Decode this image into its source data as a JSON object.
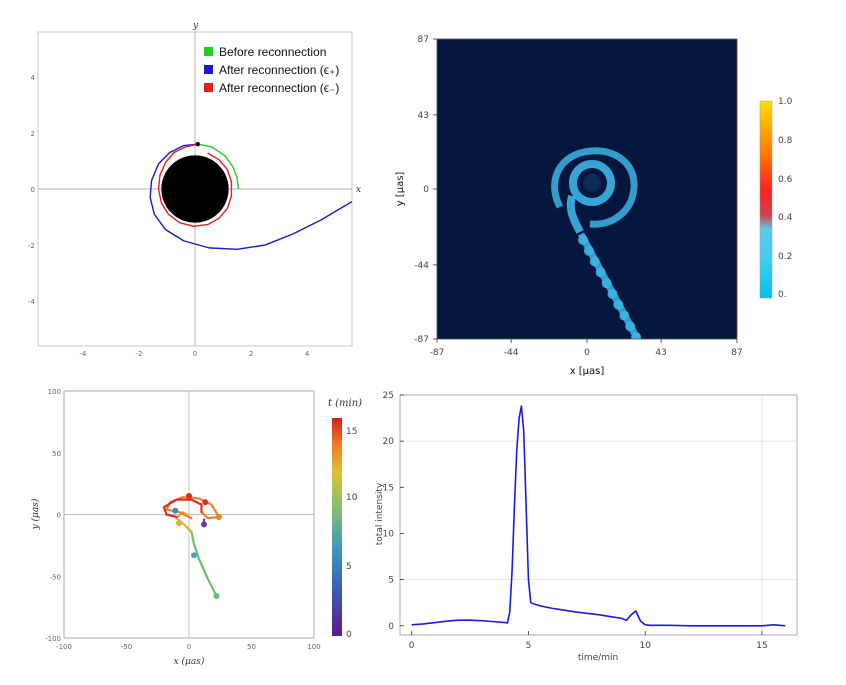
{
  "colors": {
    "before": "#22cc22",
    "after_plus": "#1a1acc",
    "after_minus": "#e02020",
    "black_hole": "#000000",
    "image_bg": "#05173c",
    "blob": "#3cb4e6",
    "intensity_line": "#1a1ae0"
  },
  "chart_data": [
    {
      "type": "line",
      "panel": "top-left",
      "xlabel": "x",
      "ylabel": "y",
      "xlim": [
        -5.6,
        5.6
      ],
      "ylim": [
        -5.6,
        5.6
      ],
      "xticks": [
        "-4",
        "-2",
        "0",
        "2",
        "4"
      ],
      "yticks": [
        "-4",
        "-2",
        "0",
        "2",
        "4"
      ],
      "legend": [
        {
          "label": "Before reconnection",
          "color": "#22cc22"
        },
        {
          "label": "After reconnection (ϵ₊)",
          "color": "#1a1acc"
        },
        {
          "label": "After reconnection (ϵ₋)",
          "color": "#e02020"
        }
      ],
      "legend_position": "top-right",
      "black_hole_radius": 1.2,
      "series": [
        {
          "name": "Before reconnection",
          "points": [
            [
              1.55,
              0
            ],
            [
              1.5,
              0.4
            ],
            [
              1.35,
              0.8
            ],
            [
              1.05,
              1.2
            ],
            [
              0.6,
              1.5
            ],
            [
              0.1,
              1.6
            ]
          ]
        },
        {
          "name": "After reconnection (ϵ₊)",
          "points": [
            [
              0.1,
              1.6
            ],
            [
              -0.4,
              1.55
            ],
            [
              -0.9,
              1.3
            ],
            [
              -1.3,
              0.9
            ],
            [
              -1.55,
              0.3
            ],
            [
              -1.6,
              -0.3
            ],
            [
              -1.45,
              -0.9
            ],
            [
              -1.05,
              -1.45
            ],
            [
              -0.4,
              -1.85
            ],
            [
              0.5,
              -2.1
            ],
            [
              1.5,
              -2.15
            ],
            [
              2.5,
              -2.0
            ],
            [
              3.5,
              -1.6
            ],
            [
              4.5,
              -1.1
            ],
            [
              5.6,
              -0.45
            ]
          ]
        },
        {
          "name": "After reconnection (ϵ₋)",
          "points": [
            [
              0.1,
              1.6
            ],
            [
              -0.35,
              1.5
            ],
            [
              -0.75,
              1.3
            ],
            [
              -1.05,
              0.95
            ],
            [
              -1.25,
              0.5
            ],
            [
              -1.3,
              0
            ],
            [
              -1.2,
              -0.5
            ],
            [
              -0.95,
              -0.9
            ],
            [
              -0.55,
              -1.2
            ],
            [
              -0.05,
              -1.33
            ],
            [
              0.45,
              -1.27
            ],
            [
              0.85,
              -1.05
            ],
            [
              1.15,
              -0.7
            ],
            [
              1.3,
              -0.25
            ],
            [
              1.3,
              0.25
            ],
            [
              1.15,
              0.7
            ],
            [
              0.85,
              1.05
            ],
            [
              0.45,
              1.28
            ]
          ]
        }
      ]
    },
    {
      "type": "heatmap",
      "panel": "top-right",
      "xlabel": "x [μas]",
      "ylabel": "y [μas]",
      "xlim": [
        -87,
        87
      ],
      "ylim": [
        -87,
        87
      ],
      "xticks": [
        "-87",
        "-44",
        "0",
        "43",
        "87"
      ],
      "yticks": [
        "87",
        "43",
        "0",
        "-44",
        "-87"
      ],
      "colorbar_ticks": [
        "1.0",
        "0.8",
        "0.6",
        "0.4",
        "0.2",
        "0."
      ]
    },
    {
      "type": "line",
      "panel": "bottom-left",
      "xlabel": "x (μas)",
      "ylabel": "y (μas)",
      "xlim": [
        -100,
        100
      ],
      "ylim": [
        -100,
        100
      ],
      "xticks": [
        "-100",
        "-50",
        "0",
        "50",
        "100"
      ],
      "yticks": [
        "100",
        "50",
        "0",
        "-50",
        "-100"
      ],
      "colorbar_title": "t (min)",
      "colorbar_ticks": [
        "15",
        "10",
        "5",
        "0"
      ],
      "series": [
        {
          "color": "#6bbf6b",
          "points": [
            [
              22,
              -66
            ],
            [
              15,
              -52
            ],
            [
              8,
              -36
            ],
            [
              4,
              -24
            ],
            [
              2,
              -14
            ]
          ]
        },
        {
          "color": "#e0b030",
          "points": [
            [
              2,
              -14
            ],
            [
              -4,
              -8
            ],
            [
              -10,
              -3
            ],
            [
              -5,
              2
            ],
            [
              2,
              -3
            ]
          ]
        },
        {
          "color": "#f08020",
          "points": [
            [
              2,
              -3
            ],
            [
              -8,
              2
            ],
            [
              -18,
              4
            ],
            [
              -15,
              10
            ],
            [
              -5,
              14
            ],
            [
              8,
              13
            ],
            [
              18,
              8
            ],
            [
              24,
              -2
            ],
            [
              15,
              -3
            ],
            [
              10,
              2
            ]
          ]
        },
        {
          "color": "#d83020",
          "points": [
            [
              10,
              2
            ],
            [
              10,
              8
            ],
            [
              2,
              12
            ],
            [
              -10,
              12
            ],
            [
              -20,
              6
            ],
            [
              -18,
              0
            ],
            [
              -10,
              -2
            ]
          ]
        },
        {
          "color": "#6a3aa0",
          "points": [
            [
              12,
              -4
            ],
            [
              12,
              -8
            ]
          ]
        }
      ],
      "points": [
        {
          "x": 0,
          "y": 15,
          "color": "#d83020"
        },
        {
          "x": 13,
          "y": 10,
          "color": "#d83020"
        },
        {
          "x": 24,
          "y": -2,
          "color": "#f08020"
        },
        {
          "x": 12,
          "y": -8,
          "color": "#6a3aa0"
        },
        {
          "x": -11,
          "y": 3,
          "color": "#3a8ad0"
        },
        {
          "x": -8,
          "y": -7,
          "color": "#e0b030"
        },
        {
          "x": 4,
          "y": -33,
          "color": "#4aa0c0"
        },
        {
          "x": 22,
          "y": -66,
          "color": "#6bbf6b"
        }
      ]
    },
    {
      "type": "line",
      "panel": "bottom-right",
      "xlabel": "time/min",
      "ylabel": "total intensity",
      "xlim": [
        -0.5,
        16.5
      ],
      "ylim": [
        -1,
        25
      ],
      "xticks": [
        "0",
        "5",
        "10",
        "15"
      ],
      "yticks": [
        "0",
        "5",
        "10",
        "15",
        "20",
        "25"
      ],
      "x": [
        0,
        0.5,
        1,
        1.5,
        2,
        2.5,
        3,
        3.5,
        4,
        4.1,
        4.2,
        4.3,
        4.4,
        4.5,
        4.6,
        4.7,
        4.8,
        4.9,
        5,
        5.1,
        5.3,
        5.6,
        6,
        6.5,
        7,
        7.5,
        8,
        8.5,
        9,
        9.2,
        9.4,
        9.6,
        9.8,
        10,
        10.2,
        11,
        12,
        13,
        14,
        15,
        15.5,
        16
      ],
      "values": [
        0.1,
        0.2,
        0.35,
        0.5,
        0.6,
        0.6,
        0.55,
        0.45,
        0.35,
        0.3,
        1.5,
        6,
        13,
        19,
        22.5,
        23.8,
        21,
        13,
        5,
        2.5,
        2.3,
        2.1,
        1.9,
        1.7,
        1.5,
        1.35,
        1.2,
        1.0,
        0.8,
        0.6,
        1.2,
        1.6,
        0.5,
        0.1,
        0.05,
        0.05,
        0.0,
        0.0,
        0.0,
        0.0,
        0.1,
        0.0
      ]
    }
  ]
}
